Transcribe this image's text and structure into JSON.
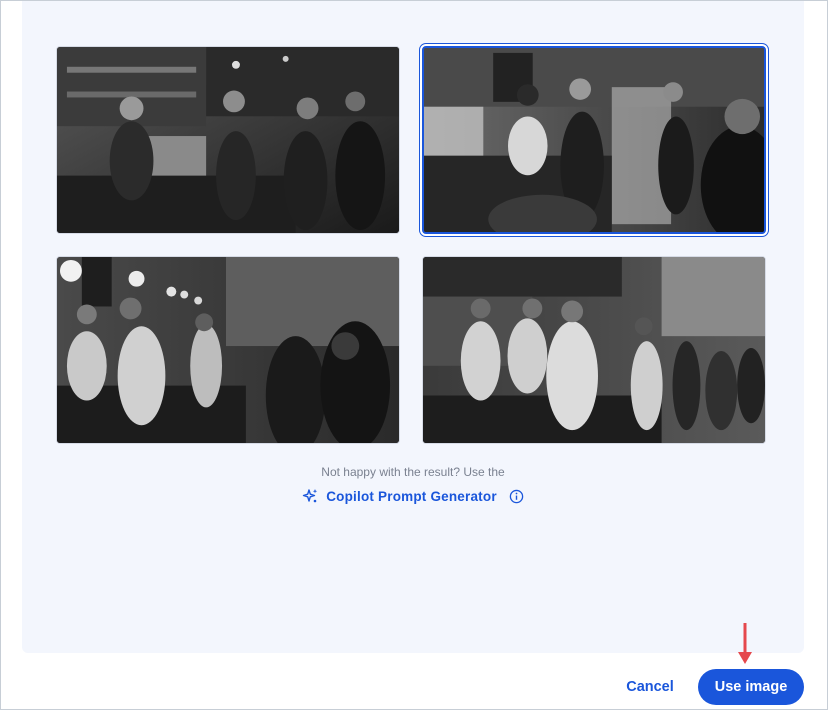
{
  "hint_text": "Not happy with the result? Use the",
  "generator_link": {
    "label": "Copilot Prompt Generator",
    "icon": "sparkle-icon",
    "info_icon": "info-icon"
  },
  "images": [
    {
      "name": "cafe-image-1",
      "selected": false
    },
    {
      "name": "cafe-image-2",
      "selected": true
    },
    {
      "name": "cafe-image-3",
      "selected": false
    },
    {
      "name": "cafe-image-4",
      "selected": false
    }
  ],
  "footer": {
    "cancel_label": "Cancel",
    "use_image_label": "Use image"
  },
  "colors": {
    "accent": "#1a56db",
    "panel_bg": "#f3f6fd",
    "arrow": "#e5484d"
  }
}
